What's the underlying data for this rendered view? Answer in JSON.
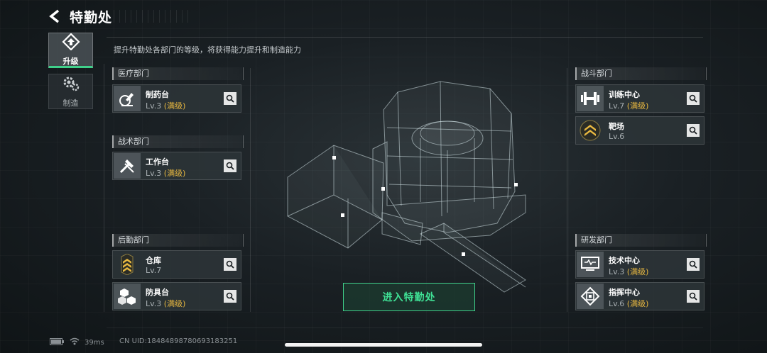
{
  "header": {
    "title": "特勤处"
  },
  "subtitle": "提升特勤处各部门的等级，将获得能力提升和制造能力",
  "tabs": [
    {
      "label": "升级",
      "active": true,
      "icon": "upgrade-icon"
    },
    {
      "label": "制造",
      "active": false,
      "icon": "gears-icon"
    }
  ],
  "departments": {
    "medical": {
      "label": "医疗部门",
      "facilities": [
        {
          "name": "制药台",
          "level": "Lv.3",
          "max": "(满级)",
          "icon": "microscope-icon"
        }
      ]
    },
    "tactical": {
      "label": "战术部门",
      "facilities": [
        {
          "name": "工作台",
          "level": "Lv.3",
          "max": "(满级)",
          "icon": "tools-icon"
        }
      ]
    },
    "logistics": {
      "label": "后勤部门",
      "facilities": [
        {
          "name": "仓库",
          "level": "Lv.7",
          "max": "",
          "icon": "chevron-rank-icon"
        },
        {
          "name": "防具台",
          "level": "Lv.3",
          "max": "(满级)",
          "icon": "cubes-icon"
        }
      ]
    },
    "combat": {
      "label": "战斗部门",
      "facilities": [
        {
          "name": "训练中心",
          "level": "Lv.7",
          "max": "(满级)",
          "icon": "dumbbell-icon"
        },
        {
          "name": "靶场",
          "level": "Lv.6",
          "max": "",
          "icon": "chevron-rank-icon"
        }
      ]
    },
    "research": {
      "label": "研发部门",
      "facilities": [
        {
          "name": "技术中心",
          "level": "Lv.3",
          "max": "(满级)",
          "icon": "monitor-icon"
        },
        {
          "name": "指挥中心",
          "level": "Lv.6",
          "max": "(满级)",
          "icon": "chip-icon"
        }
      ]
    }
  },
  "enter_button": "进入特勤处",
  "status": {
    "ping": "39ms",
    "uid": "CN UID:18484898780693183251"
  },
  "colors": {
    "accent_green": "#3fd08a",
    "max_gold": "#e8b840"
  }
}
